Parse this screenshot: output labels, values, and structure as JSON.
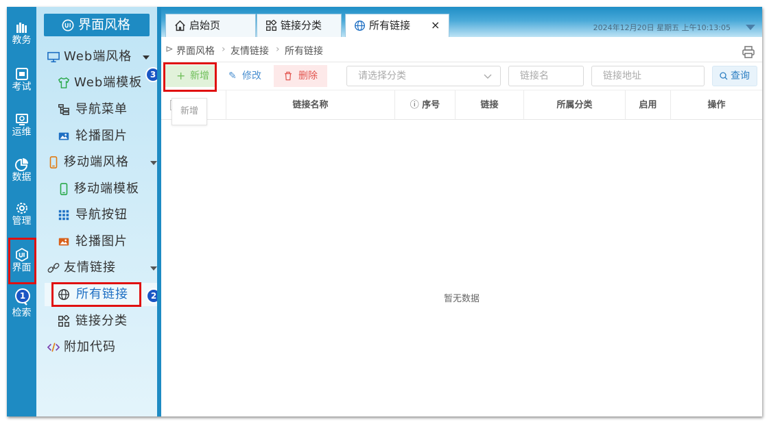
{
  "rail": [
    {
      "label": "教务",
      "icon": "books-icon"
    },
    {
      "label": "考试",
      "icon": "exam-icon"
    },
    {
      "label": "运维",
      "icon": "monitor-gear-icon"
    },
    {
      "label": "数据",
      "icon": "pie-chart-icon"
    },
    {
      "label": "管理",
      "icon": "gear-icon"
    },
    {
      "label": "界面",
      "icon": "ui-icon"
    },
    {
      "label": "检索",
      "icon": "search-icon"
    }
  ],
  "menu": {
    "title": "界面风格",
    "items": [
      {
        "label": "Web端风格",
        "icon": "desktop-icon"
      },
      {
        "label": "Web端模板",
        "icon": "shirt-icon"
      },
      {
        "label": "导航菜单",
        "icon": "tree-icon"
      },
      {
        "label": "轮播图片",
        "icon": "image-icon"
      },
      {
        "label": "移动端风格",
        "icon": "mobile-icon"
      },
      {
        "label": "移动端模板",
        "icon": "mobile-outline-icon"
      },
      {
        "label": "导航按钮",
        "icon": "grid-icon"
      },
      {
        "label": "轮播图片",
        "icon": "image-icon"
      },
      {
        "label": "友情链接",
        "icon": "link-icon"
      },
      {
        "label": "所有链接",
        "icon": "globe-icon"
      },
      {
        "label": "链接分类",
        "icon": "category-icon"
      },
      {
        "label": "附加代码",
        "icon": "code-icon"
      }
    ]
  },
  "badges": [
    "1",
    "2",
    "3"
  ],
  "tabs": [
    {
      "label": "启始页",
      "icon": "home-icon"
    },
    {
      "label": "链接分类",
      "icon": "category-icon"
    },
    {
      "label": "所有链接",
      "icon": "globe-icon",
      "close": "×"
    }
  ],
  "datetime": "2024年12月20日 星期五 上午10:13:05",
  "breadcrumb": [
    "界面风格",
    "友情链接",
    "所有链接"
  ],
  "breadcrumb_sep": "›",
  "toolbar": {
    "add": "新增",
    "edit": "修改",
    "delete": "删除",
    "category_placeholder": "请选择分类",
    "name_placeholder": "链接名",
    "url_placeholder": "链接地址",
    "query": "查询",
    "tooltip": "新增"
  },
  "table": {
    "columns": [
      "链接名称",
      "序号",
      "链接",
      "所属分类",
      "启用",
      "操作"
    ],
    "empty": "暂无数据"
  },
  "colors": {
    "primary": "#1e8bc3",
    "highlight": "#e01010",
    "badge": "#1a56c4",
    "add": "#5cb85c",
    "delete": "#e2554f"
  }
}
